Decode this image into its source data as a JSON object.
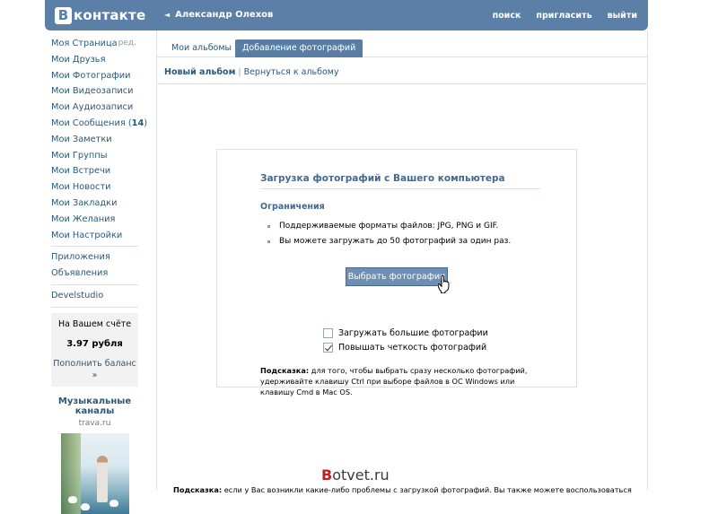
{
  "header": {
    "logo_letter": "В",
    "logo_text": "контакте",
    "back_arrow": "◄",
    "user_name": "Александр Олехов",
    "links": [
      "поиск",
      "пригласить",
      "выйти"
    ],
    "bg_color": "#5b7fa6"
  },
  "sidebar": {
    "edit_label": "ред.",
    "items": [
      {
        "label": "Моя Страница"
      },
      {
        "label": "Мои Друзья"
      },
      {
        "label": "Мои Фотографии"
      },
      {
        "label": "Мои Видеозаписи"
      },
      {
        "label": "Мои Аудиозаписи"
      },
      {
        "label": "Мои Сообщения",
        "count": "14"
      },
      {
        "label": "Мои Заметки"
      },
      {
        "label": "Мои Группы"
      },
      {
        "label": "Мои Встречи"
      },
      {
        "label": "Мои Новости"
      },
      {
        "label": "Мои Закладки"
      },
      {
        "label": "Мои Желания"
      },
      {
        "label": "Мои Настройки"
      }
    ],
    "items2": [
      {
        "label": "Приложения"
      },
      {
        "label": "Объявления"
      }
    ],
    "items3": [
      {
        "label": "Develstudio"
      }
    ],
    "balance": {
      "title": "На Вашем счёте",
      "value": "3.97 рубля",
      "link": "Пополнить баланс »"
    },
    "ad": {
      "title": "Музыкальные каналы",
      "domain": "trava.ru"
    }
  },
  "tabs": [
    {
      "label": "Мои альбомы",
      "active": false
    },
    {
      "label": "Добавление фотографий",
      "active": true
    }
  ],
  "subnav": {
    "current": "Новый альбом",
    "separator": "|",
    "link": "Вернуться к альбому"
  },
  "upload": {
    "title": "Загрузка фотографий с Вашего компьютера",
    "limits_heading": "Ограничения",
    "limits": [
      "Поддерживаемые форматы файлов:  JPG, PNG и GIF.",
      "Вы можете загружать до 50 фотографий за один раз."
    ],
    "choose_button": "Выбрать фотографии",
    "checkboxes": [
      {
        "label": "Загружать большие фотографии",
        "checked": false
      },
      {
        "label": "Повышать четкость фотографий",
        "checked": true
      }
    ],
    "hint_label": "Подсказка:",
    "hint_text": " для того, чтобы выбрать сразу несколько фотографий, удерживайте клавишу Ctrl при выборе файлов в ОС Windows или клавишу Cmd в Mac OS."
  },
  "bottom_hint": {
    "label": "Подсказка:",
    "text": " если у Вас возникли какие-либо проблемы с загрузкой фотографий. Вы также можете воспользоваться"
  },
  "watermark": {
    "first": "B",
    "rest": "otvet.ru"
  }
}
